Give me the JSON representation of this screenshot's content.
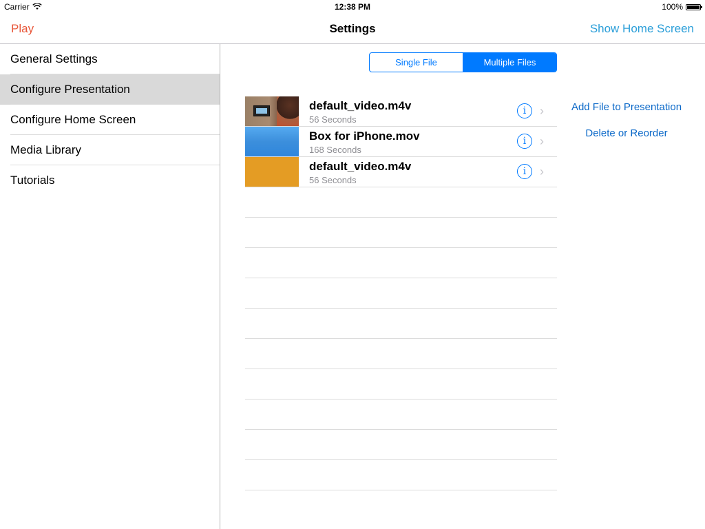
{
  "status_bar": {
    "carrier": "Carrier",
    "time": "12:38 PM",
    "battery": "100%"
  },
  "nav": {
    "left_button": "Play",
    "title": "Settings",
    "right_button": "Show Home Screen",
    "colors": {
      "left": "#e8573a",
      "right": "#2c9fd9"
    }
  },
  "sidebar": {
    "items": [
      {
        "label": "General Settings"
      },
      {
        "label": "Configure Presentation",
        "selected": true
      },
      {
        "label": "Configure Home Screen"
      },
      {
        "label": "Media Library"
      },
      {
        "label": "Tutorials"
      }
    ]
  },
  "segment": {
    "options": [
      "Single File",
      "Multiple Files"
    ],
    "selected": "Multiple Files"
  },
  "files": [
    {
      "name": "default_video.m4v",
      "duration": "56 Seconds",
      "thumb": "video-frame"
    },
    {
      "name": "Box for iPhone.mov",
      "duration": "168 Seconds",
      "thumb": "blue"
    },
    {
      "name": "default_video.m4v",
      "duration": "56 Seconds",
      "thumb": "orange"
    }
  ],
  "actions": {
    "add": "Add File to Presentation",
    "delete": "Delete or Reorder"
  },
  "icons": {
    "info": "info-icon",
    "chevron": "chevron-right-icon",
    "wifi": "wifi-icon",
    "battery": "battery-icon"
  },
  "accent_color": "#007aff"
}
